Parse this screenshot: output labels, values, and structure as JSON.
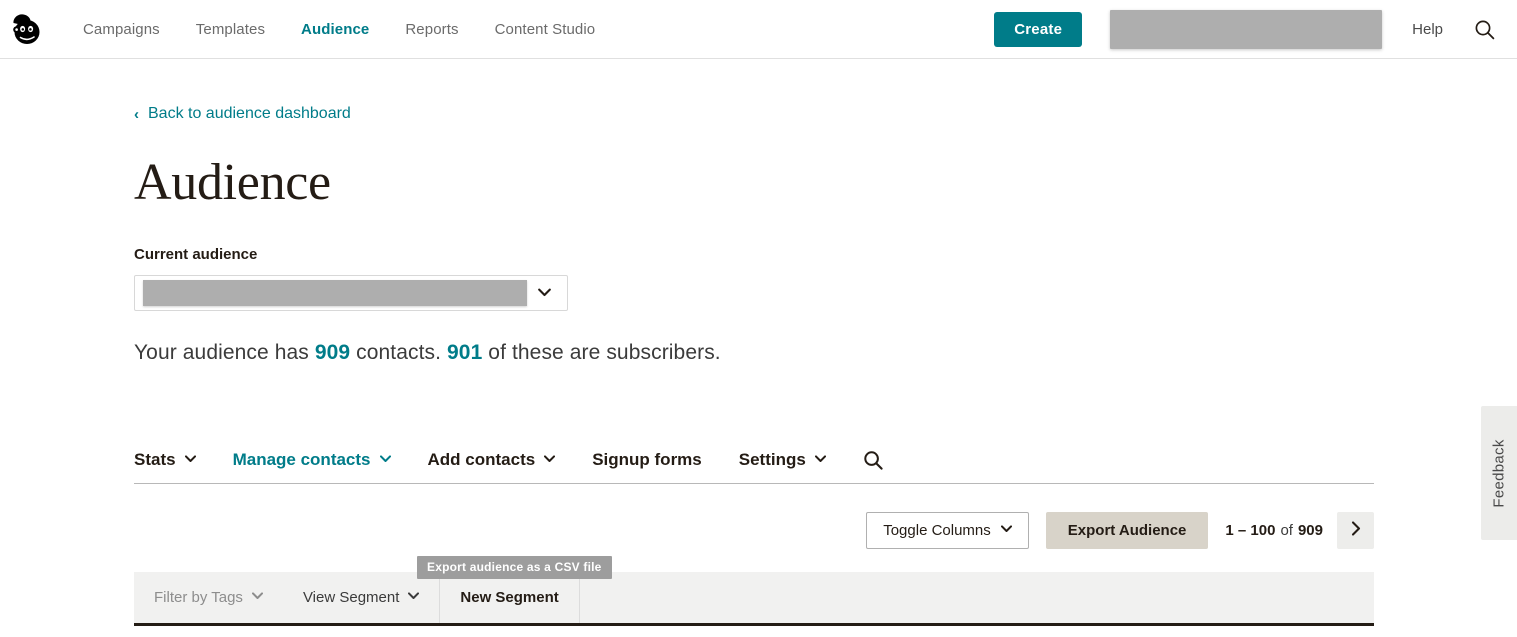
{
  "topnav": {
    "logo_alt": "Mailchimp",
    "links": [
      {
        "label": "Campaigns",
        "active": false
      },
      {
        "label": "Templates",
        "active": false
      },
      {
        "label": "Audience",
        "active": true
      },
      {
        "label": "Reports",
        "active": false
      },
      {
        "label": "Content Studio",
        "active": false
      }
    ],
    "create_label": "Create",
    "account_redacted": "",
    "help_label": "Help",
    "search_icon": "search-icon"
  },
  "breadcrumb": {
    "back_label": "Back to audience dashboard",
    "chevron": "‹"
  },
  "page": {
    "title": "Audience"
  },
  "audience_selector": {
    "label": "Current audience",
    "selected_value_redacted": "",
    "chevron_icon": "chevron-down-icon"
  },
  "summary": {
    "prefix": "Your audience has",
    "contacts_count": "909",
    "middle": "contacts.",
    "subscribers_count": "901",
    "suffix": "of these are subscribers."
  },
  "tabs": [
    {
      "label": "Stats",
      "has_caret": true,
      "active": false
    },
    {
      "label": "Manage contacts",
      "has_caret": true,
      "active": true
    },
    {
      "label": "Add contacts",
      "has_caret": true,
      "active": false
    },
    {
      "label": "Signup forms",
      "has_caret": false,
      "active": false
    },
    {
      "label": "Settings",
      "has_caret": true,
      "active": false
    }
  ],
  "tab_search_icon": "search-icon",
  "toolbar": {
    "toggle_columns_label": "Toggle Columns",
    "export_label": "Export Audience",
    "export_tooltip": "Export audience as a CSV file",
    "pagination_range": "1 – 100",
    "pagination_of": "of",
    "pagination_total": "909",
    "next_page_icon": "chevron-right-icon"
  },
  "filterbar": {
    "filter_tags_label": "Filter by Tags",
    "view_segment_label": "View Segment",
    "new_segment_label": "New Segment"
  },
  "feedback": {
    "label": "Feedback"
  },
  "colors": {
    "brand_teal": "#007c89",
    "export_button_bg": "#d8d3c9",
    "tooltip_bg": "#9d9d9d",
    "filterbar_bg": "#f1f1f0",
    "redaction": "#aeaeae"
  }
}
